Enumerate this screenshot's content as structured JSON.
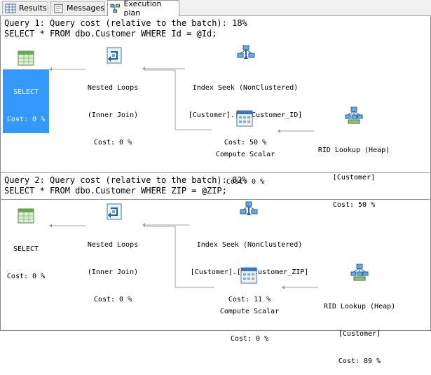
{
  "tabs": [
    {
      "label": "Results",
      "icon": "grid-icon"
    },
    {
      "label": "Messages",
      "icon": "messages-icon"
    },
    {
      "label": "Execution plan",
      "icon": "execution-plan-icon",
      "active": true
    }
  ],
  "queries": [
    {
      "cost_line": "Query 1: Query cost (relative to the batch): 18%",
      "sql_line": "SELECT * FROM dbo.Customer WHERE Id = @Id;",
      "nodes": {
        "select": {
          "line1": "SELECT",
          "line2": "Cost: 0 %"
        },
        "nested_loops": {
          "line1": "Nested Loops",
          "line2": "(Inner Join)",
          "line3": "Cost: 0 %"
        },
        "index_seek": {
          "line1": "Index Seek (NonClustered)",
          "line2": "[Customer].[ix_Customer_ID]",
          "line3": "Cost: 50 %"
        },
        "compute_scalar": {
          "line1": "Compute Scalar",
          "line2": "Cost: 0 %"
        },
        "rid_lookup": {
          "line1": "RID Lookup (Heap)",
          "line2": "[Customer]",
          "line3": "Cost: 50 %"
        }
      }
    },
    {
      "cost_line": "Query 2: Query cost (relative to the batch): 82%",
      "sql_line": "SELECT * FROM dbo.Customer WHERE ZIP = @ZIP;",
      "nodes": {
        "select": {
          "line1": "SELECT",
          "line2": "Cost: 0 %"
        },
        "nested_loops": {
          "line1": "Nested Loops",
          "line2": "(Inner Join)",
          "line3": "Cost: 0 %"
        },
        "index_seek": {
          "line1": "Index Seek (NonClustered)",
          "line2": "[Customer].[ix_Customer_ZIP]",
          "line3": "Cost: 11 %"
        },
        "compute_scalar": {
          "line1": "Compute Scalar",
          "line2": "Cost: 0 %"
        },
        "rid_lookup": {
          "line1": "RID Lookup (Heap)",
          "line2": "[Customer]",
          "line3": "Cost: 89 %"
        }
      }
    }
  ],
  "colors": {
    "selection": "#3399ff",
    "connector": "#a0a0a0"
  }
}
